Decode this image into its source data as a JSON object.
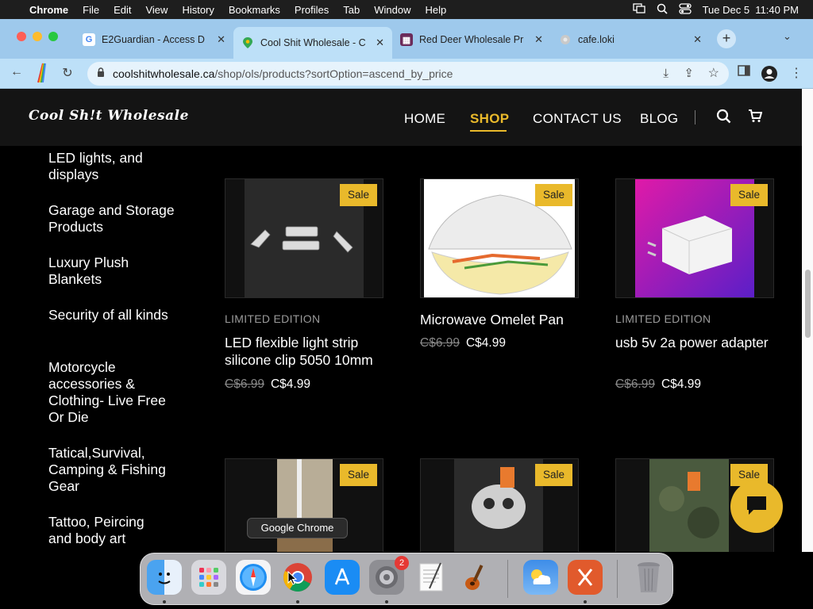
{
  "menubar": {
    "app_name": "Chrome",
    "items": [
      "File",
      "Edit",
      "View",
      "History",
      "Bookmarks",
      "Profiles",
      "Tab",
      "Window",
      "Help"
    ],
    "datetime": "Tue Dec 5  11:40 PM"
  },
  "tabs": [
    {
      "title": "E2Guardian - Access D",
      "favicon": "google-icon"
    },
    {
      "title": "Cool Shit Wholesale - C",
      "favicon": "maps-pin-icon",
      "active": true
    },
    {
      "title": "Red Deer Wholesale Pr",
      "favicon": "store-icon"
    },
    {
      "title": "cafe.loki",
      "favicon": "globe-icon"
    }
  ],
  "address_bar": {
    "host": "coolshitwholesale.ca",
    "path": "/shop/ols/products?sortOption=ascend_by_price"
  },
  "site": {
    "logo": "Cool Sh!t Wholesale",
    "nav": [
      {
        "label": "HOME"
      },
      {
        "label": "SHOP",
        "active": true
      },
      {
        "label": "CONTACT US"
      },
      {
        "label": "BLOG"
      }
    ]
  },
  "categories": [
    "LED lights, and displays",
    "Garage and Storage Products",
    "Luxury Plush Blankets",
    "Security of all kinds",
    "Motorcycle accessories & Clothing- Live Free Or Die",
    "Tatical,Survival, Camping & Fishing Gear",
    "Tattoo, Peircing and body art"
  ],
  "products": [
    {
      "badge": "Sale",
      "label": "LIMITED EDITION",
      "name": "LED flexible light strip silicone clip 5050 10mm",
      "old_price": "C$6.99",
      "price": "C$4.99"
    },
    {
      "badge": "Sale",
      "label": "",
      "name": "Microwave Omelet Pan",
      "old_price": "C$6.99",
      "price": "C$4.99"
    },
    {
      "badge": "Sale",
      "label": "LIMITED EDITION",
      "name": "usb 5v 2a power adapter",
      "old_price": "C$6.99",
      "price": "C$4.99"
    },
    {
      "badge": "Sale"
    },
    {
      "badge": "Sale"
    },
    {
      "badge": "Sale"
    }
  ],
  "dock": {
    "tooltip": "Google Chrome",
    "settings_badge": "2"
  }
}
